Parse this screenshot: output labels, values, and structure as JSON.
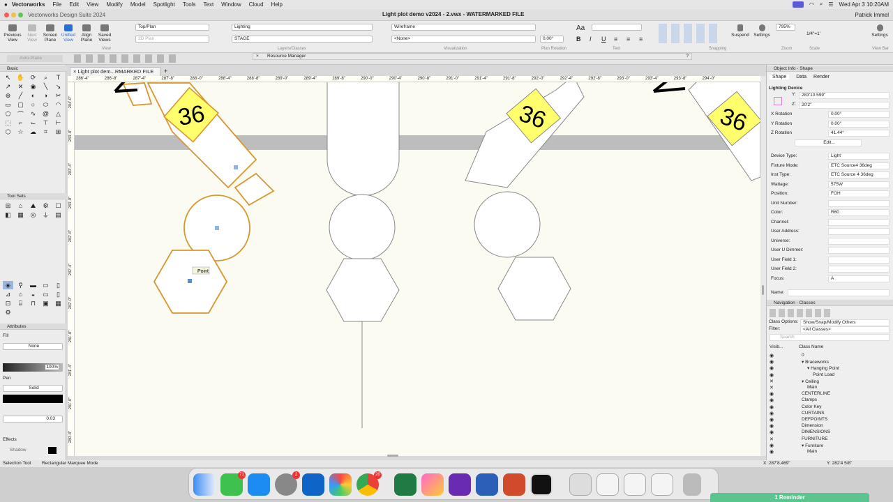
{
  "menubar": {
    "apple": "",
    "app": "Vectorworks",
    "items": [
      "File",
      "Edit",
      "View",
      "Modify",
      "Model",
      "Spotlight",
      "Tools",
      "Text",
      "Window",
      "Cloud",
      "Help"
    ],
    "clock": "Wed Apr 3  10:20AM"
  },
  "titlebar": {
    "suite": "Vectorworks Design Suite 2024",
    "doc": "Light plot demo v2024 - 2.vwx - WATERMARKED FILE",
    "user": "Patrick Immel"
  },
  "toolbar": {
    "buttons": [
      "Previous View",
      "Next View",
      "Screen Plane",
      "Unified View",
      "Align Plane",
      "Saved Views"
    ],
    "view_label": "View",
    "view_dd": "Top/Plan",
    "plane_dd": "2D Plan",
    "layers_dd": "Lighting",
    "class_dd": "STAGE",
    "layers_group": "Layers/Classes",
    "render_dd": "Wireframe",
    "none_dd": "<None>",
    "vis_group": "Visualization",
    "rotation_value": "0.00°",
    "rotation_group": "Plan Rotation",
    "text_group": "Text",
    "snap_group": "Snapping",
    "zoom_value": "795%",
    "zoom_group": "Zoom",
    "scale_value": "1/4\"=1'",
    "scale_group": "Scale",
    "suspend": "Suspend",
    "settings": "Settings",
    "settings2": "Settings",
    "viewbar": "View Bar",
    "rm": "Resource Manager",
    "autoplane": "Auto-Plane"
  },
  "left": {
    "basic": "Basic",
    "toolsets": "Tool Sets",
    "attributes": "Attributes",
    "fill": "Fill",
    "fill_value": "None",
    "opacity": "100%",
    "pen": "Pen",
    "pen_value": "Solid",
    "line_weight": "0.03",
    "effects": "Effects",
    "shadow": "Shadow"
  },
  "doc_tab": "Light plot dem...RMARKED FILE",
  "ruler": [
    "286'-4\"",
    "286'-8\"",
    "287'-4\"",
    "287'-8\"",
    "288'-0\"",
    "288'-4\"",
    "288'-8\"",
    "289'-0\"",
    "289'-4\"",
    "289'-8\"",
    "290'-0\"",
    "290'-4\"",
    "290'-8\"",
    "291'-0\"",
    "291'-4\"",
    "291'-8\"",
    "292'-0\"",
    "292'-4\"",
    "292'-8\"",
    "293'-0\"",
    "293'-4\"",
    "293'-8\"",
    "294'-0\""
  ],
  "vruler": [
    "284'-0\"",
    "283'-8\"",
    "283'-4\"",
    "283'-0\"",
    "282'-8\"",
    "282'-4\"",
    "282'-0\"",
    "281'-8\"",
    "281'-4\"",
    "281'-0\"",
    "280'-8\""
  ],
  "canvas": {
    "fixture_label": "36",
    "tooltip": "Point"
  },
  "oip": {
    "title": "Object Info - Shape",
    "tabs": [
      "Shape",
      "Data",
      "Render"
    ],
    "type": "Lighting Device",
    "y": "283'10.599\"",
    "z": "20'2\"",
    "rows": [
      [
        "X Rotation",
        "0.00°"
      ],
      [
        "Y Rotation",
        "0.00°"
      ],
      [
        "Z Rotation",
        "41.44°"
      ],
      [
        "",
        "Edit..."
      ],
      [
        "Device Type:",
        "Light"
      ],
      [
        "Fixture Mode:",
        "ETC Source4 36deg"
      ],
      [
        "Inst Type:",
        "ETC Source 4 36deg"
      ],
      [
        "Wattage:",
        "575W"
      ],
      [
        "Position:",
        "FOH"
      ],
      [
        "Unit Number:",
        ""
      ],
      [
        "Color:",
        "R60"
      ],
      [
        "Channel:",
        ""
      ],
      [
        "User Address:",
        ""
      ],
      [
        "Universe:",
        ""
      ],
      [
        "User U Dimmer:",
        ""
      ],
      [
        "User Field 1:",
        ""
      ],
      [
        "User Field 2:",
        ""
      ],
      [
        "Focus:",
        "A"
      ]
    ],
    "name_label": "Name:"
  },
  "nav": {
    "title": "Navigation - Classes",
    "class_options_label": "Class Options:",
    "class_options": "Show/Snap/Modify Others",
    "filter_label": "Filter:",
    "filter": "<All Classes>",
    "search": "Search",
    "col_vis": "Visib...",
    "col_name": "Class Name",
    "classes": [
      [
        "eye",
        "0",
        0
      ],
      [
        "eye",
        "▾ Braceworks",
        0
      ],
      [
        "eye",
        "▾ Hanging Point",
        1
      ],
      [
        "eye",
        "Point Load",
        2
      ],
      [
        "x",
        "▾ Ceiling",
        0
      ],
      [
        "x",
        "Main",
        1
      ],
      [
        "eye",
        "CENTERLINE",
        0
      ],
      [
        "eye",
        "Clamps",
        0
      ],
      [
        "eye",
        "Color Key",
        0
      ],
      [
        "eye",
        "CURTAINS",
        0
      ],
      [
        "eye",
        "DEFPOINTS",
        0
      ],
      [
        "eye",
        "Dimension",
        0
      ],
      [
        "eye",
        "DIMENSIONS",
        0
      ],
      [
        "x",
        "FURNITURE",
        0
      ],
      [
        "eye",
        "▾ Furniture",
        0
      ],
      [
        "eye",
        "Main",
        1
      ]
    ]
  },
  "status": {
    "tool": "Selection Tool",
    "mode": "Rectangular Marquee Mode",
    "x": "X: 287'8.469\"",
    "y": "Y: 282'4 5/8\""
  },
  "dock": {
    "messages_badge": "71",
    "settings_badge": "2",
    "chrome_badge": "20"
  },
  "reminder": "1 Reminder"
}
